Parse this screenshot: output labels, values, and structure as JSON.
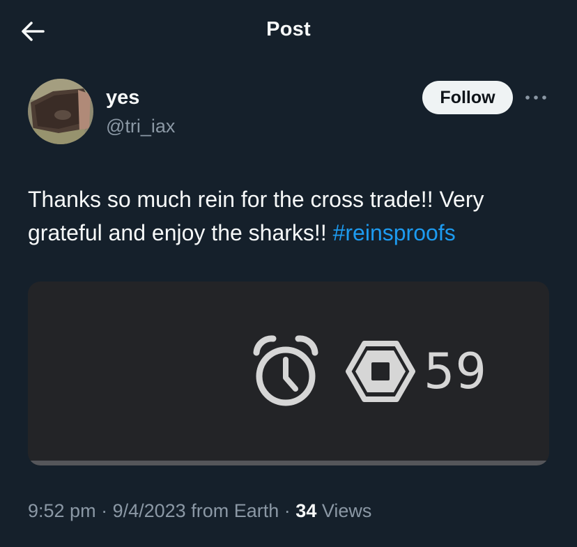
{
  "header": {
    "title": "Post",
    "back_icon": "arrow-left-icon"
  },
  "author": {
    "display_name": "yes",
    "handle": "@tri_iax",
    "follow_label": "Follow",
    "more_icon": "more-horizontal-icon"
  },
  "post": {
    "text": "Thanks so much rein for the cross trade!! Very grateful and enjoy the sharks!! ",
    "hashtag": "#reinsproofs"
  },
  "media": {
    "icons": [
      "alarm-clock-icon",
      "robux-icon"
    ],
    "value": "59"
  },
  "meta": {
    "time": "9:52 pm",
    "sep1": "·",
    "date": "9/4/2023",
    "location": "from Earth",
    "sep2": "·",
    "views_count": "34",
    "views_label": "Views"
  },
  "colors": {
    "background": "#15202b",
    "text_primary": "#f7f9f9",
    "text_secondary": "#8b98a5",
    "link": "#1d9bf0",
    "follow_button_bg": "#eff3f4",
    "media_bg": "#232427"
  }
}
